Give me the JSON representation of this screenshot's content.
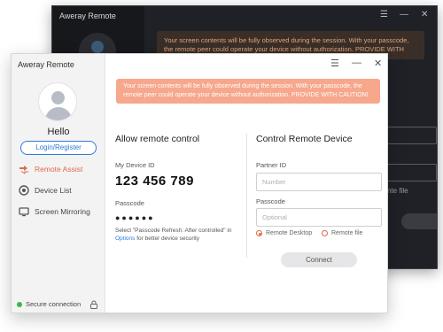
{
  "back_window": {
    "title": "Aweray Remote",
    "warning": "Your screen contents will be fully observed during the session. With your passcode, the remote peer could operate your device without authorization. PROVIDE WITH CAUTION!",
    "partial_label": "nte file"
  },
  "app": {
    "title": "Aweray Remote",
    "window_controls": {
      "menu": "☰",
      "minimize": "—",
      "close": "✕"
    }
  },
  "sidebar": {
    "greeting": "Hello",
    "login_label": "Login/Register",
    "nav": [
      {
        "label": "Remote Assist",
        "icon": "remote-assist-icon",
        "active": true
      },
      {
        "label": "Device List",
        "icon": "device-list-icon",
        "active": false
      },
      {
        "label": "Screen Mirroring",
        "icon": "screen-mirroring-icon",
        "active": false
      }
    ],
    "status": {
      "label": "Secure connection",
      "color": "#3bb54a"
    }
  },
  "warning": "Your screen contents will be fully observed during the session. With your passcode, the remote peer could operate your device without authorization. PROVIDE WITH CAUTION!",
  "allow": {
    "title": "Allow remote control",
    "device_id_label": "My Device ID",
    "device_id": "123 456 789",
    "passcode_label": "Passcode",
    "passcode": "●●●●●●",
    "note_prefix": "Select \"Passcode Refresh: After controlled\" in ",
    "note_link": "Options",
    "note_suffix": " for better device security"
  },
  "control": {
    "title": "Control Remote Device",
    "partner_label": "Partner ID",
    "partner_placeholder": "Number",
    "passcode_label": "Passcode",
    "passcode_placeholder": "Optional",
    "options": [
      {
        "label": "Remote Desktop",
        "selected": true
      },
      {
        "label": "Remote file",
        "selected": false
      }
    ],
    "connect_label": "Connect"
  },
  "colors": {
    "accent": "#e06a4a",
    "warning_bg": "#f7a78c",
    "link": "#2d7bd6"
  }
}
